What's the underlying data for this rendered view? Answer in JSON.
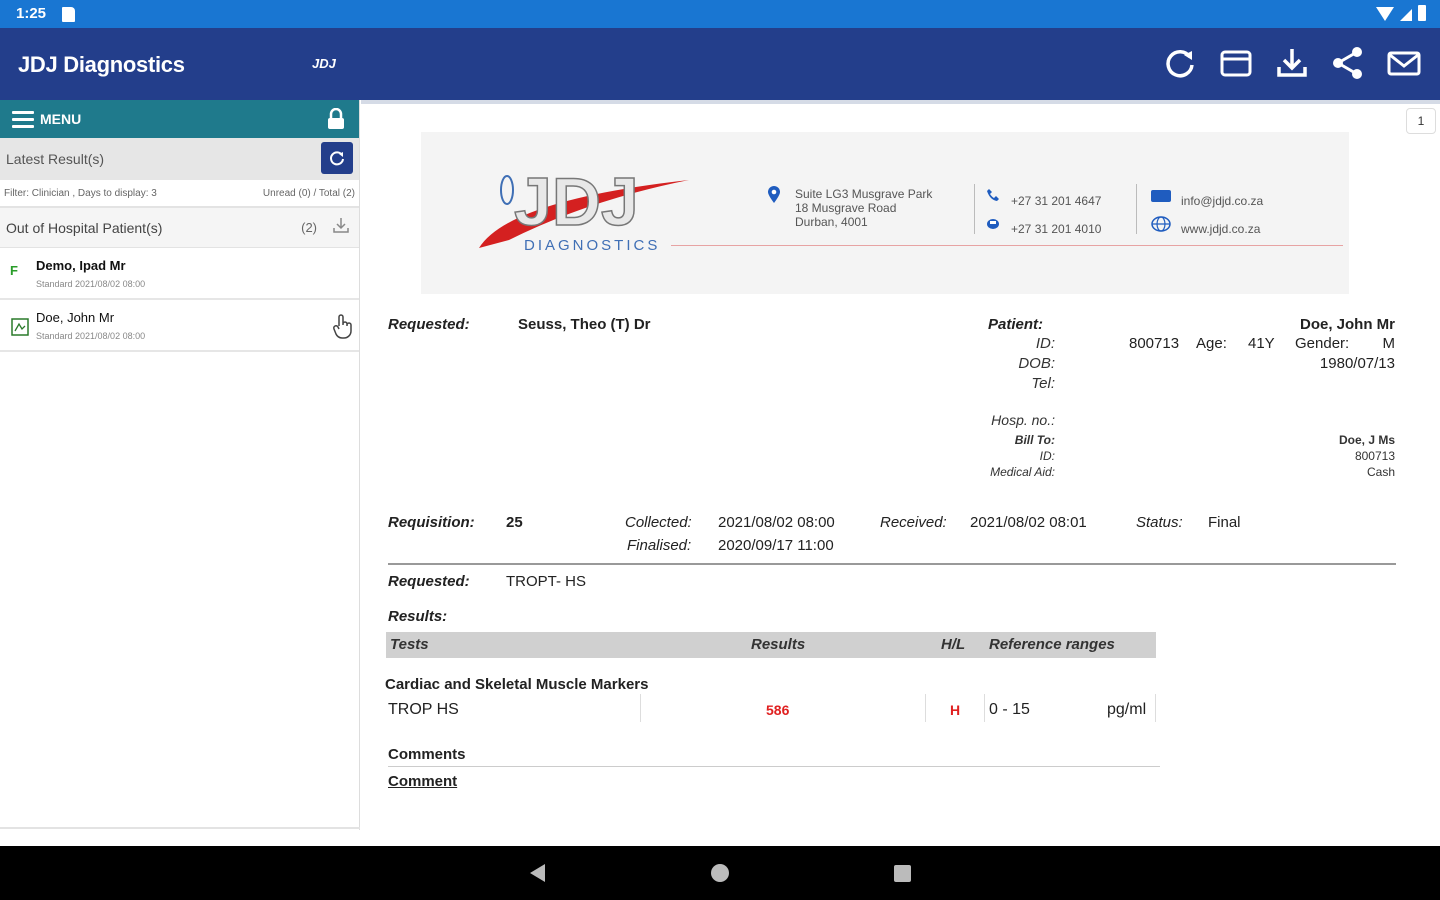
{
  "status": {
    "time": "1:25"
  },
  "app": {
    "title": "JDJ Diagnostics",
    "logo_mini": "JDJ"
  },
  "sidebar": {
    "menu_label": "MENU",
    "latest_label": "Latest Result(s)",
    "filter_text": "Filter: Clinician , Days to display: 3",
    "unread_text": "Unread (0) / Total (2)",
    "ooh_label": "Out of Hospital Patient(s)",
    "ooh_count": "(2)",
    "patients": [
      {
        "name": "Demo, Ipad Mr",
        "sub": "Standard 2021/08/02 08:00",
        "flag": "F"
      },
      {
        "name": "Doe, John Mr",
        "sub": "Standard 2021/08/02 08:00"
      }
    ]
  },
  "letterhead": {
    "logo_text": "JDJ",
    "logo_sub": "DIAGNOSTICS",
    "address": [
      "Suite LG3 Musgrave Park",
      "18 Musgrave Road",
      "Durban, 4001"
    ],
    "tel": "+27 31 201 4647",
    "fax": "+27 31 201 4010",
    "email": "info@jdjd.co.za",
    "web": "www.jdjd.co.za"
  },
  "report": {
    "page_number": "1",
    "requested_label": "Requested:",
    "requested_value": "Seuss, Theo (T) Dr",
    "patient_label": "Patient:",
    "patient_name": "Doe, John Mr",
    "id_label": "ID:",
    "id_value": "800713",
    "age_label": "Age:",
    "age_value": "41Y",
    "gender_label": "Gender:",
    "gender_value": "M",
    "dob_label": "DOB:",
    "dob_value": "1980/07/13",
    "tel_label": "Tel:",
    "hosp_label": "Hosp. no.:",
    "billto_label": "Bill To:",
    "billto_value": "Doe, J Ms",
    "bill_id_label": "ID:",
    "bill_id_value": "800713",
    "medaid_label": "Medical Aid:",
    "medaid_value": "Cash",
    "requisition_label": "Requisition:",
    "requisition_value": "25",
    "collected_label": "Collected:",
    "collected_value": "2021/08/02 08:00",
    "received_label": "Received:",
    "received_value": "2021/08/02 08:01",
    "status_label": "Status:",
    "status_value": "Final",
    "finalised_label": "Finalised:",
    "finalised_value": "2020/09/17 11:00",
    "requested2_label": "Requested:",
    "requested2_value": "TROPT- HS",
    "results_label": "Results:",
    "table_headers": {
      "tests": "Tests",
      "results": "Results",
      "hl": "H/L",
      "ref": "Reference ranges"
    },
    "section_title": "Cardiac and Skeletal Muscle Markers",
    "rows": [
      {
        "test": "TROP HS",
        "result": "586",
        "flag": "H",
        "range": "0 - 15",
        "unit": "pg/ml"
      }
    ],
    "comments_label": "Comments",
    "comment_label": "Comment"
  },
  "colors": {
    "appbar": "#233e8b",
    "statusbar": "#1976d2",
    "menubar": "#1f7a8c",
    "high": "#e02020"
  }
}
